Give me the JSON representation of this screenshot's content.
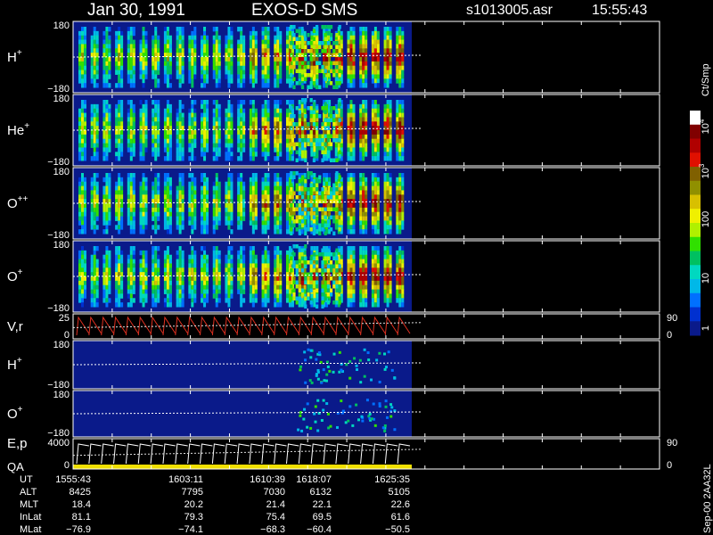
{
  "header": {
    "date": "Jan 30, 1991",
    "instrument": "EXOS-D SMS",
    "filename": "s1013005.asr",
    "time": "15:55:43"
  },
  "colorbar": {
    "unit": "Ct/Smp",
    "ticks": [
      {
        "label": "1",
        "exp": ""
      },
      {
        "label": "10",
        "exp": ""
      },
      {
        "label": "100",
        "exp": ""
      },
      {
        "label": "10",
        "exp": "3"
      },
      {
        "label": "10",
        "exp": "4"
      }
    ],
    "colors": [
      "#0a1a8a",
      "#0030d0",
      "#0070ff",
      "#00b8e8",
      "#00d8c0",
      "#00c060",
      "#30e000",
      "#b0f000",
      "#f0f000",
      "#d8c000",
      "#909000",
      "#806000",
      "#e01000",
      "#b00000",
      "#800000",
      "#ffffff"
    ]
  },
  "side_note": "Sep-00  2AA32L",
  "chart_data": {
    "type": "heatmap",
    "panels": [
      {
        "label": "H",
        "sup": "+",
        "ymax": "180",
        "ymin": "−180",
        "kind": "spectrogram"
      },
      {
        "label": "He",
        "sup": "+",
        "ymax": "180",
        "ymin": "−180",
        "kind": "spectrogram"
      },
      {
        "label": "O",
        "sup": "++",
        "ymax": "180",
        "ymin": "−180",
        "kind": "spectrogram"
      },
      {
        "label": "O",
        "sup": "+",
        "ymax": "180",
        "ymin": "−180",
        "kind": "spectrogram"
      },
      {
        "label": "V,r",
        "sup": "",
        "ymax": "25",
        "ymin": "0",
        "right_max": "90",
        "right_min": "0",
        "kind": "line"
      },
      {
        "label": "H",
        "sup": "+",
        "ymax": "180",
        "ymin": "−180",
        "kind": "spectrogram_sparse"
      },
      {
        "label": "O",
        "sup": "+",
        "ymax": "180",
        "ymin": "−180",
        "kind": "spectrogram_sparse"
      },
      {
        "label": "E,p",
        "label2": "QA",
        "sup": "",
        "ymax": "4000",
        "ymin": "0",
        "right_max": "90",
        "right_min": "0",
        "kind": "line"
      }
    ],
    "ephemeris": {
      "rows": [
        "UT",
        "ALT",
        "MLT",
        "InLat",
        "MLat"
      ],
      "columns": [
        [
          "1555:43",
          "8425",
          "18.4",
          "81.1",
          "−76.9"
        ],
        [
          "1603:11",
          "7795",
          "20.2",
          "79.3",
          "−74.1"
        ],
        [
          "1610:39",
          "7030",
          "21.4",
          "75.4",
          "−68.3"
        ],
        [
          "1618:07",
          "6132",
          "22.1",
          "69.5",
          "−60.4"
        ],
        [
          "1625:35",
          "5105",
          "22.6",
          "61.6",
          "−50.5"
        ]
      ]
    },
    "spin_stripes": {
      "count": 27,
      "data_end_fraction": 0.365
    }
  }
}
